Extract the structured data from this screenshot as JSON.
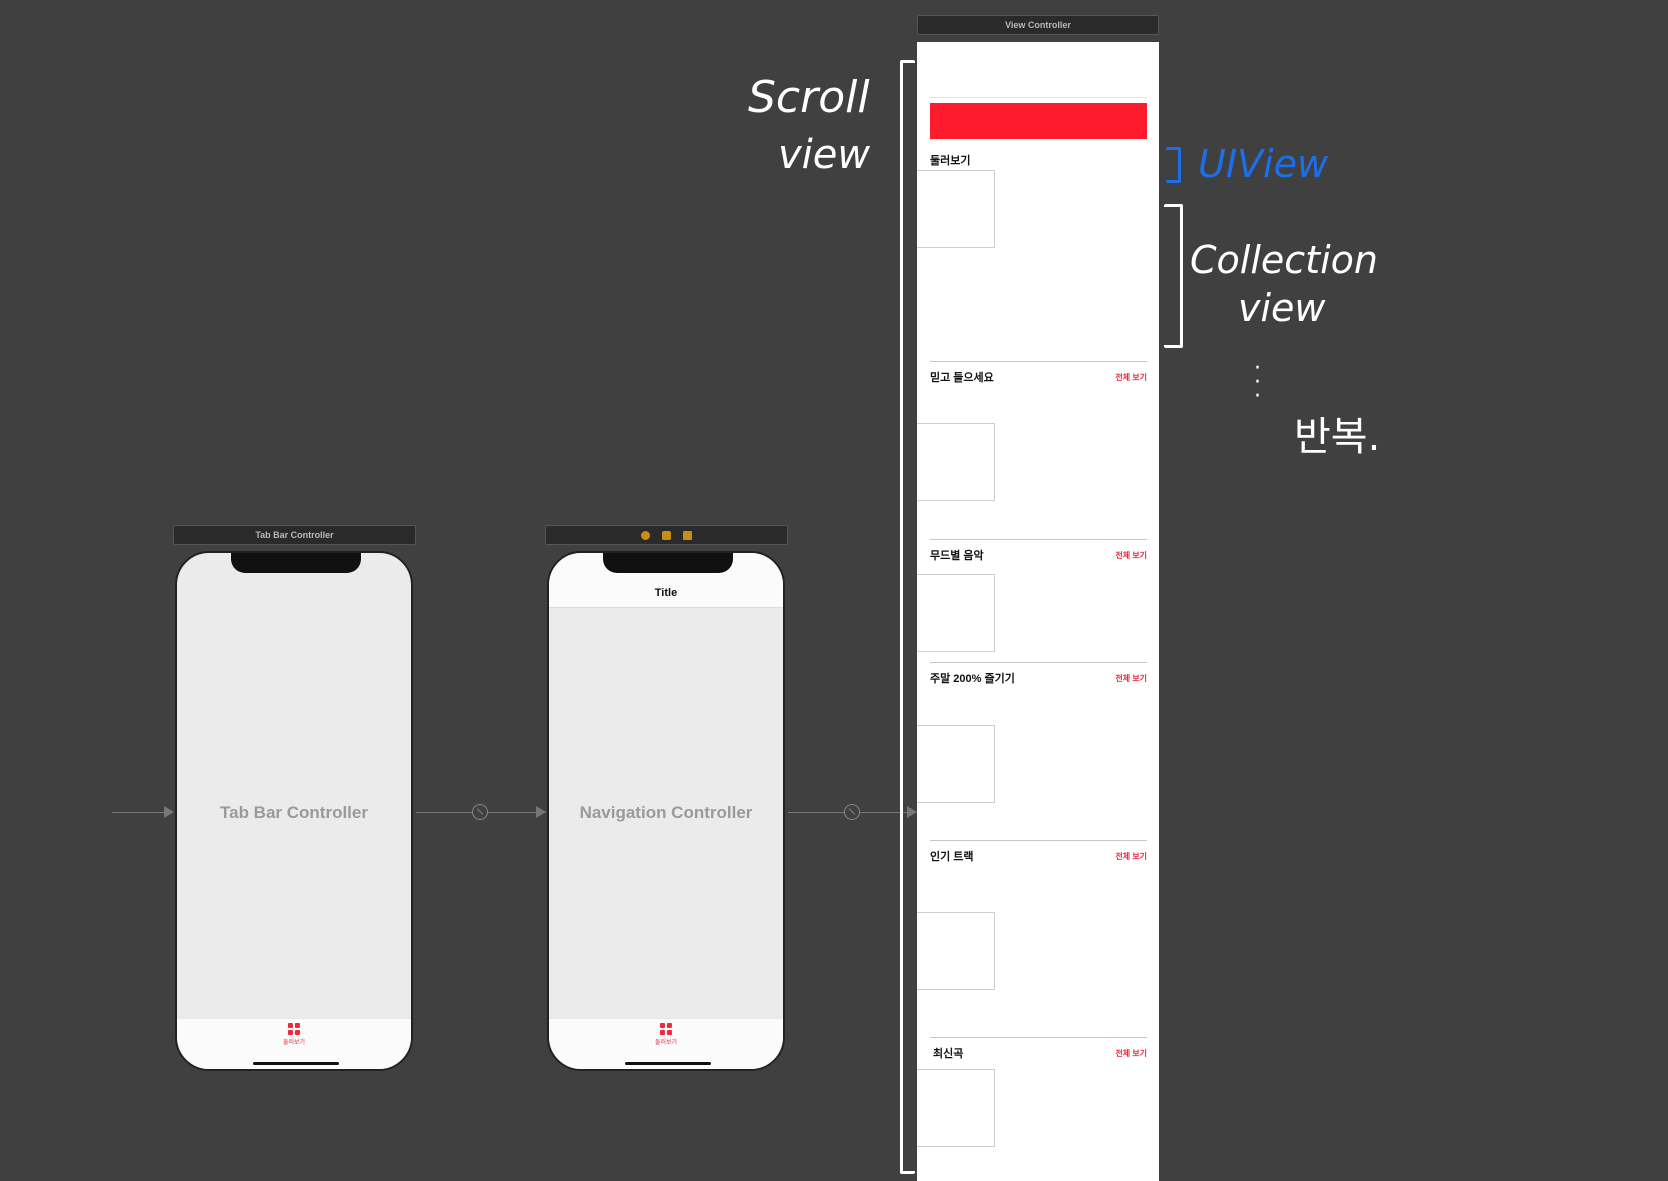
{
  "tab_bar_scene": {
    "header": "Tab Bar Controller",
    "center_label": "Tab Bar Controller",
    "tab_item_label": "둘러보기"
  },
  "nav_scene": {
    "title": "Title",
    "center_label": "Navigation Controller",
    "tab_item_label": "둘러보기"
  },
  "view_controller": {
    "header": "View Controller",
    "first_section_title": "둘러보기",
    "sections": [
      {
        "title": "믿고 들으세요",
        "see_all": "전체 보기"
      },
      {
        "title": "무드별 음악",
        "see_all": "전체 보기"
      },
      {
        "title": "주말 200% 즐기기",
        "see_all": "전체 보기"
      },
      {
        "title": "인기 트랙",
        "see_all": "전체 보기"
      },
      {
        "title": "최신곡",
        "see_all": "전체 보기"
      }
    ],
    "banner_color": "#fe1b2c"
  },
  "annotations": {
    "scroll_view": [
      "Scroll",
      "view"
    ],
    "ui_view": "UIView",
    "collection_view": [
      "Collection",
      "view"
    ],
    "repeat": "반복."
  },
  "colors": {
    "canvas": "#404040",
    "accent_red": "#f0283c",
    "annotation_blue": "#1c6fe8"
  }
}
